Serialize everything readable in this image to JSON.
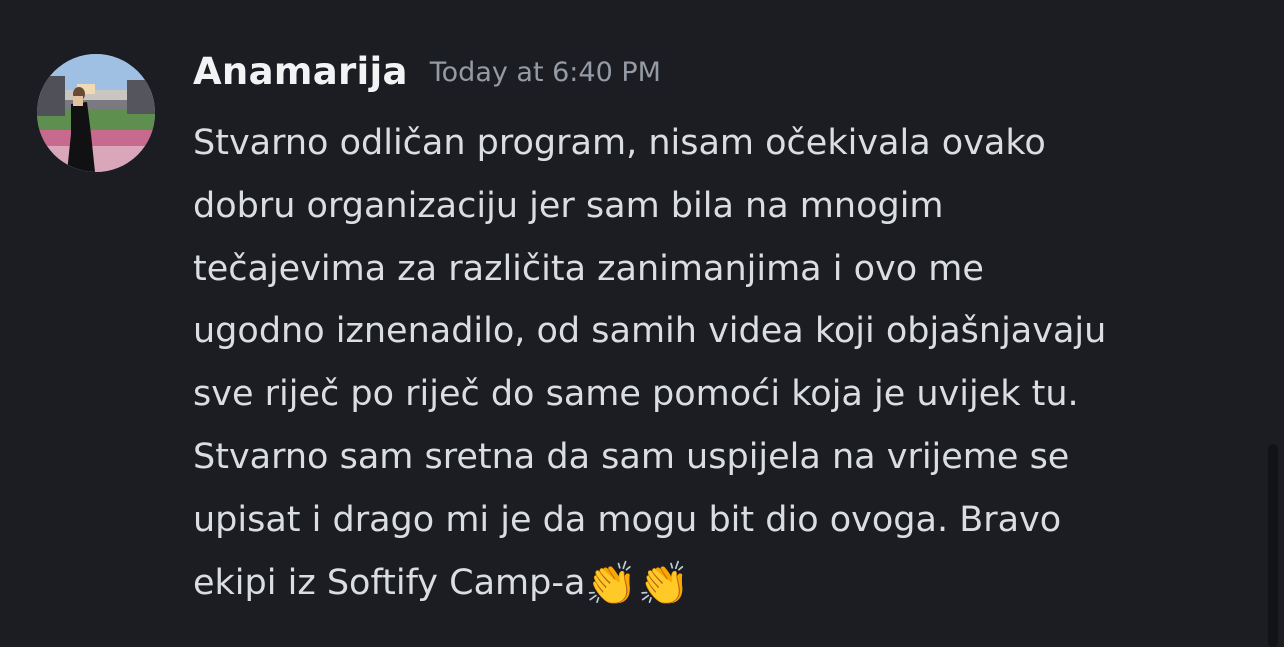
{
  "message": {
    "author": "Anamarija",
    "timestamp": "Today at 6:40 PM",
    "lines": [
      "Stvarno odličan program, nisam očekivala ovako",
      "dobru organizaciju jer sam bila na mnogim",
      "tečajevima za različita zanimanjima i ovo me",
      "ugodno iznenadilo, od samih videa koji objašnjavaju",
      "sve riječ po riječ do same pomoći koja je uvijek tu.",
      "Stvarno sam sretna da sam uspijela na vrijeme se",
      "upisat i drago mi je da mogu bit dio ovoga. Bravo",
      "ekipi iz Softify Camp-a"
    ],
    "emoji": "👏👏"
  },
  "colors": {
    "background": "#1c1d22",
    "author": "#f2f3f5",
    "timestamp": "#949ba4",
    "text": "#dbdee1"
  }
}
